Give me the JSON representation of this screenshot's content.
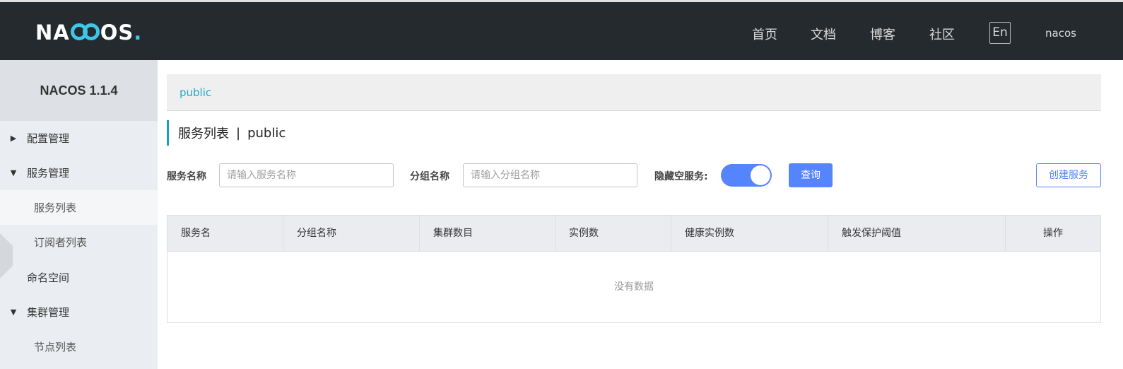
{
  "header": {
    "logo": {
      "left": "NA",
      "right": "OS",
      "dot": "."
    },
    "nav": [
      "首页",
      "文档",
      "博客",
      "社区"
    ],
    "lang": "En",
    "user": "nacos"
  },
  "sidebar": {
    "version": "NACOS 1.1.4",
    "items": [
      {
        "label": "配置管理",
        "arrow": "right"
      },
      {
        "label": "服务管理",
        "arrow": "down"
      },
      {
        "label": "服务列表",
        "active": true
      },
      {
        "label": "订阅者列表"
      },
      {
        "label": "命名空间"
      },
      {
        "label": "集群管理",
        "arrow": "down"
      },
      {
        "label": "节点列表"
      }
    ]
  },
  "namespace": {
    "current": "public"
  },
  "page": {
    "title": "服务列表",
    "separator": "|",
    "namespace": "public"
  },
  "filters": {
    "service_name_label": "服务名称",
    "service_name_placeholder": "请输入服务名称",
    "group_name_label": "分组名称",
    "group_name_placeholder": "请输入分组名称",
    "hide_empty_label": "隐藏空服务:",
    "hide_empty_on": true,
    "query_button": "查询",
    "create_button": "创建服务"
  },
  "table": {
    "columns": [
      "服务名",
      "分组名称",
      "集群数目",
      "实例数",
      "健康实例数",
      "触发保护阈值",
      "操作"
    ],
    "empty_text": "没有数据"
  },
  "colors": {
    "accent": "#5584ff",
    "header_bg": "#252a2f",
    "link": "#22a9cd"
  }
}
